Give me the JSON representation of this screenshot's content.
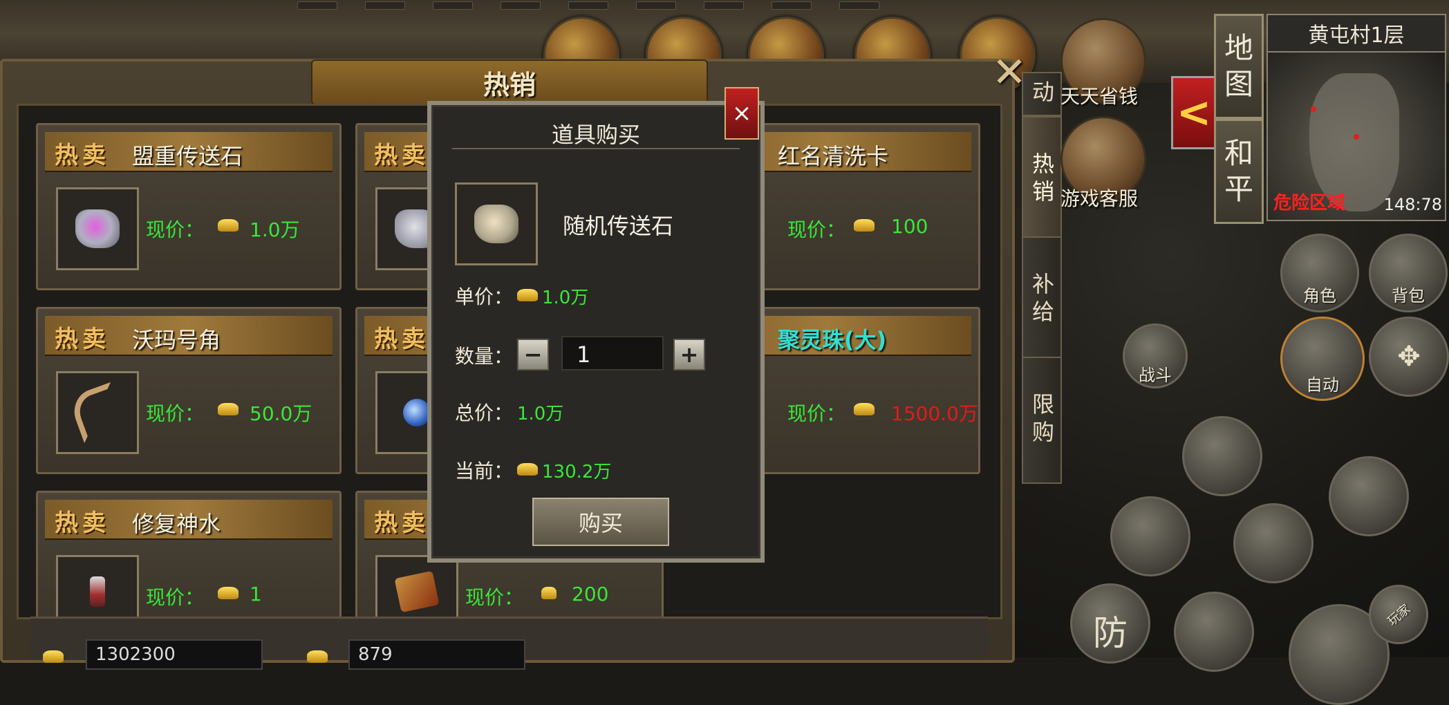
{
  "shop": {
    "title": "热销",
    "close_glyph": "✕",
    "side_tabs": [
      {
        "label": "动"
      },
      {
        "label": "热销"
      },
      {
        "label": "补给"
      },
      {
        "label": "限购"
      }
    ],
    "hot_tag": "热卖",
    "price_label": "现价：",
    "cards": [
      {
        "name": "盟重传送石",
        "price": "1.0万"
      },
      {
        "name": "",
        "price": ""
      },
      {
        "name": "红名清洗卡",
        "price": "100"
      },
      {
        "name": "沃玛号角",
        "price": "50.0万"
      },
      {
        "name": "",
        "price": ""
      },
      {
        "name": "聚灵珠(大)",
        "price": "1500.0万"
      },
      {
        "name": "修复神水",
        "price": "1"
      },
      {
        "name": "",
        "price": "200"
      }
    ],
    "bottom": {
      "gold_amount": "1302300",
      "ingot_amount": "879"
    }
  },
  "dialog": {
    "title": "道具购买",
    "close_glyph": "×",
    "item_name": "随机传送石",
    "unit_price_label": "单价：",
    "unit_price": "1.0万",
    "quantity_label": "数量：",
    "quantity": "1",
    "minus_glyph": "−",
    "plus_glyph": "+",
    "total_label": "总价：",
    "total": "1.0万",
    "current_label": "当前：",
    "current": "130.2万",
    "buy_label": "购买"
  },
  "minimap": {
    "map_tab": "地图",
    "peace_tab": "和平",
    "location": "黄屯村1层",
    "danger_label": "危险区域",
    "coords": "148:78"
  },
  "hud": {
    "features": [
      {
        "label": "天天省钱"
      },
      {
        "label": "游戏客服"
      }
    ],
    "buttons": {
      "role": "角色",
      "bag": "背包",
      "auto": "自动",
      "battle": "战斗",
      "defense": "防",
      "player": "玩家"
    },
    "back_arrow": "<"
  },
  "colors": {
    "price_green": "#38e838",
    "price_red": "#e81818",
    "teal_name": "#30e0d0",
    "danger_red": "#ff2020"
  }
}
